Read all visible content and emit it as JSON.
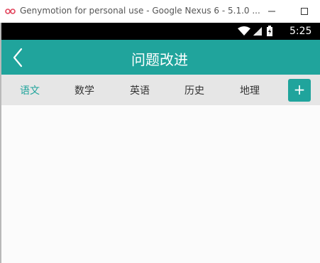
{
  "window": {
    "title": "Genymotion for personal use - Google Nexus 6 - 5.1.0 ..."
  },
  "status_bar": {
    "time": "5:25",
    "icons": [
      "wifi-icon",
      "signal-icon",
      "battery-icon"
    ]
  },
  "header": {
    "title": "问题改进",
    "back_icon": "chevron-left-icon"
  },
  "tabs": [
    {
      "label": "语文",
      "active": true
    },
    {
      "label": "数学",
      "active": false
    },
    {
      "label": "英语",
      "active": false
    },
    {
      "label": "历史",
      "active": false
    },
    {
      "label": "地理",
      "active": false
    }
  ],
  "add_button": {
    "label": "+"
  },
  "colors": {
    "accent": "#20a49c",
    "tab_bar_bg": "#e6e6e6",
    "content_bg": "#fbfbfb",
    "status_bar_bg": "#000000"
  }
}
